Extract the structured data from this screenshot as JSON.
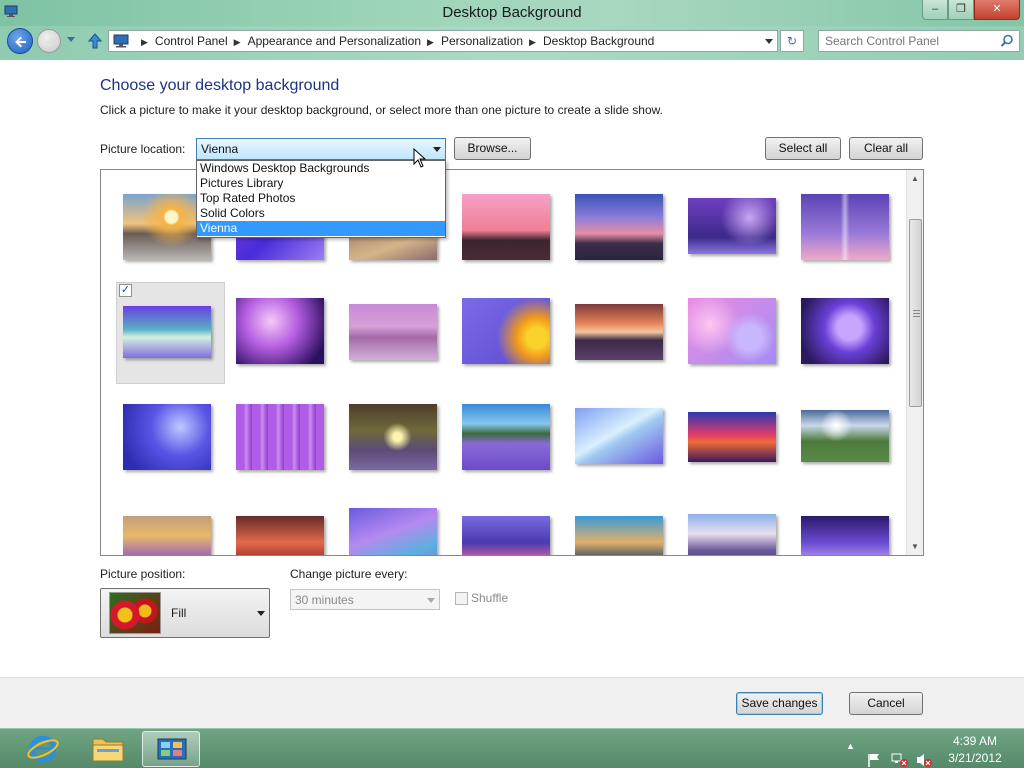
{
  "window": {
    "title": "Desktop Background",
    "minimize": "‒",
    "maximize": "❐",
    "close": "✕"
  },
  "address": {
    "crumbs": [
      "Control Panel",
      "Appearance and Personalization",
      "Personalization",
      "Desktop Background"
    ],
    "separator": "▶",
    "refresh": "↻",
    "search_placeholder": "Search Control Panel"
  },
  "page": {
    "heading": "Choose your desktop background",
    "subtext": "Click a picture to make it your desktop background, or select more than one picture to create a slide show.",
    "location_label": "Picture location:",
    "location_value": "Vienna",
    "browse": "Browse...",
    "select_all": "Select all",
    "clear_all": "Clear all",
    "location_options": [
      "Windows Desktop Backgrounds",
      "Pictures Library",
      "Top Rated Photos",
      "Solid Colors",
      "Vienna"
    ],
    "location_selected_index": 4,
    "selected_checkmark": "✓",
    "scroll_up": "▲",
    "scroll_down": "▼",
    "position_label": "Picture position:",
    "position_value": "Fill",
    "change_label": "Change picture every:",
    "change_value": "30 minutes",
    "shuffle_label": "Shuffle"
  },
  "footer": {
    "save": "Save changes",
    "cancel": "Cancel"
  },
  "taskbar": {
    "tray_arrow": "▲",
    "time": "4:39 AM",
    "date": "3/21/2012"
  },
  "colors": {
    "accent_heading": "#1e3287",
    "selection": "#3399ff",
    "titlebar": "#9dd5b8"
  }
}
